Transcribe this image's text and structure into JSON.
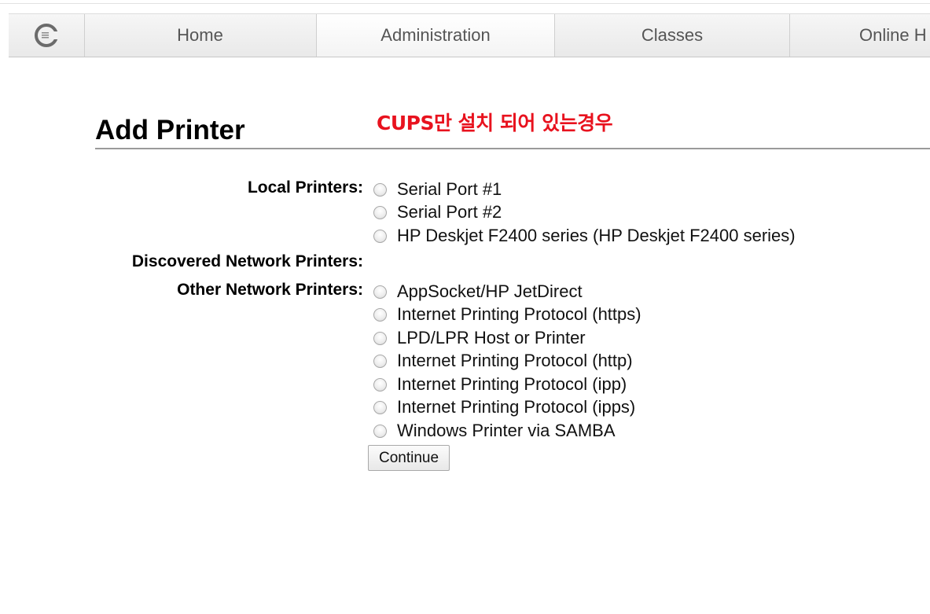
{
  "nav": {
    "logo_icon": "cups-logo-icon",
    "items": [
      {
        "label": "Home"
      },
      {
        "label": "Administration"
      },
      {
        "label": "Classes"
      },
      {
        "label": "Online H"
      }
    ],
    "active_index": 1
  },
  "annotation": "CUPS만 설치 되어 있는경우",
  "page": {
    "title": "Add Printer"
  },
  "form": {
    "local_printers": {
      "label": "Local Printers:",
      "options": [
        "Serial Port #1",
        "Serial Port #2",
        "HP Deskjet F2400 series (HP Deskjet F2400 series)"
      ]
    },
    "discovered_network_printers": {
      "label": "Discovered Network Printers:"
    },
    "other_network_printers": {
      "label": "Other Network Printers:",
      "options": [
        "AppSocket/HP JetDirect",
        "Internet Printing Protocol (https)",
        "LPD/LPR Host or Printer",
        "Internet Printing Protocol (http)",
        "Internet Printing Protocol (ipp)",
        "Internet Printing Protocol (ipps)",
        "Windows Printer via SAMBA"
      ]
    },
    "continue_label": "Continue"
  },
  "colors": {
    "annotation": "#e8121e",
    "nav_text": "#555555",
    "rule": "#9a9a9a"
  }
}
